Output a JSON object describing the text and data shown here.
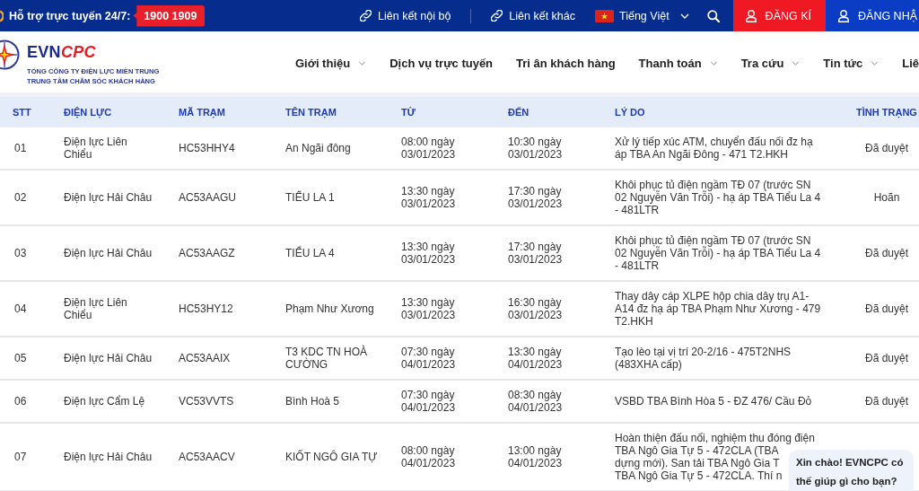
{
  "top_bar": {
    "support_label": "Hỗ trợ trực tuyến 24/7:",
    "hotline": "1900 1909",
    "links": [
      {
        "label": "Liên kết nội bộ"
      },
      {
        "label": "Liên kết khác"
      }
    ],
    "language": "Tiếng Việt",
    "buttons": [
      {
        "label": "ĐĂNG KÍ",
        "kind": "register"
      },
      {
        "label": "ĐĂNG NHẬ",
        "kind": "login"
      }
    ]
  },
  "header": {
    "brand": {
      "main": "EVN",
      "accent": "CPC"
    },
    "org_line_1": "TỔNG CÔNG TY ĐIỆN LỰC MIỀN TRUNG",
    "org_line_2": "TRUNG TÂM CHĂM SÓC KHÁCH HÀNG",
    "nav": [
      {
        "label": "Giới thiệu",
        "has_menu": true
      },
      {
        "label": "Dịch vụ trực tuyến",
        "has_menu": false
      },
      {
        "label": "Tri ân khách hàng",
        "has_menu": false
      },
      {
        "label": "Thanh toán",
        "has_menu": true
      },
      {
        "label": "Tra cứu",
        "has_menu": true
      },
      {
        "label": "Tin tức",
        "has_menu": true
      },
      {
        "label": "Liê",
        "has_menu": false
      }
    ]
  },
  "table": {
    "columns": [
      "STT",
      "ĐIỆN LỰC",
      "MÃ TRẠM",
      "TÊN TRẠM",
      "TỪ",
      "ĐẾN",
      "LÝ DO",
      "TÌNH TRẠNG"
    ],
    "rows": [
      {
        "stt": "01",
        "unit": "Điện lực Liên Chiểu",
        "code": "HC53HHY4",
        "station": "An Ngãi đông",
        "from": "08:00 ngày 03/01/2023",
        "to": "10:30 ngày 03/01/2023",
        "reason": "Xử lý tiếp xúc ATM, chuyển đấu nối đz hạ áp TBA An Ngãi Đông - 471 T2.HKH",
        "status": "Đã duyệt"
      },
      {
        "stt": "02",
        "unit": "Điện lực Hải Châu",
        "code": "AC53AAGU",
        "station": "TIỂU LA 1",
        "from": "13:30 ngày 03/01/2023",
        "to": "17:30 ngày 03/01/2023",
        "reason": "Khôi phục tủ điện ngầm TĐ 07 (trước SN 02 Nguyễn Văn Trỗi) - hạ áp TBA Tiểu La 4 - 481LTR",
        "status": "Hoãn"
      },
      {
        "stt": "03",
        "unit": "Điện lực Hải Châu",
        "code": "AC53AAGZ",
        "station": "TIỂU LA 4",
        "from": "13:30 ngày 03/01/2023",
        "to": "17:30 ngày 03/01/2023",
        "reason": "Khôi phục tủ điện ngầm TĐ 07 (trước SN 02 Nguyễn Văn Trỗi) - hạ áp TBA Tiểu La 4 - 481LTR",
        "status": "Đã duyệt"
      },
      {
        "stt": "04",
        "unit": "Điện lực Liên Chiểu",
        "code": "HC53HY12",
        "station": "Phạm Như Xương",
        "from": "13:30 ngày 03/01/2023",
        "to": "16:30 ngày 03/01/2023",
        "reason": "Thay dây cáp XLPE hộp chia dây trụ A1-A14 đz hạ áp TBA Phạm Như Xương - 479 T2.HKH",
        "status": "Đã duyệt"
      },
      {
        "stt": "05",
        "unit": "Điện lực Hải Châu",
        "code": "AC53AAIX",
        "station": "T3 KDC TN HOÀ CƯỜNG",
        "from": "07:30 ngày 04/01/2023",
        "to": "13:30 ngày 04/01/2023",
        "reason": "Tạo lèo tại vị trí 20-2/16 - 475T2NHS (483XHA cấp)",
        "status": "Đã duyệt"
      },
      {
        "stt": "06",
        "unit": "Điện lực Cẩm Lệ",
        "code": "VC53VVTS",
        "station": "Bình Hoà 5",
        "from": "07:30 ngày 04/01/2023",
        "to": "08:30 ngày 04/01/2023",
        "reason": "VSBD TBA Bình Hòa 5 - ĐZ 476/ Cầu Đỏ",
        "status": "Đã duyệt"
      },
      {
        "stt": "07",
        "unit": "Điện lực Hải Châu",
        "code": "AC53AACV",
        "station": "KIỐT NGÔ GIA TỰ",
        "from": "08:00 ngày 04/01/2023",
        "to": "13:00 ngày 04/01/2023",
        "reason_visible_lines": [
          "Hoàn thiện đấu nối, nghiệm thu đóng điện",
          "TBA Ngô Gia Tự 5 - 472CLA (TBA",
          "dựng mới). San tải TBA Ngô Gia T",
          "TBA Ngô Gia Tự 5 - 472CLA. Thí n"
        ]
      }
    ]
  },
  "chat_bubble": {
    "text": "Xin chào! EVNCPC có thế giúp gì cho bạn?"
  }
}
